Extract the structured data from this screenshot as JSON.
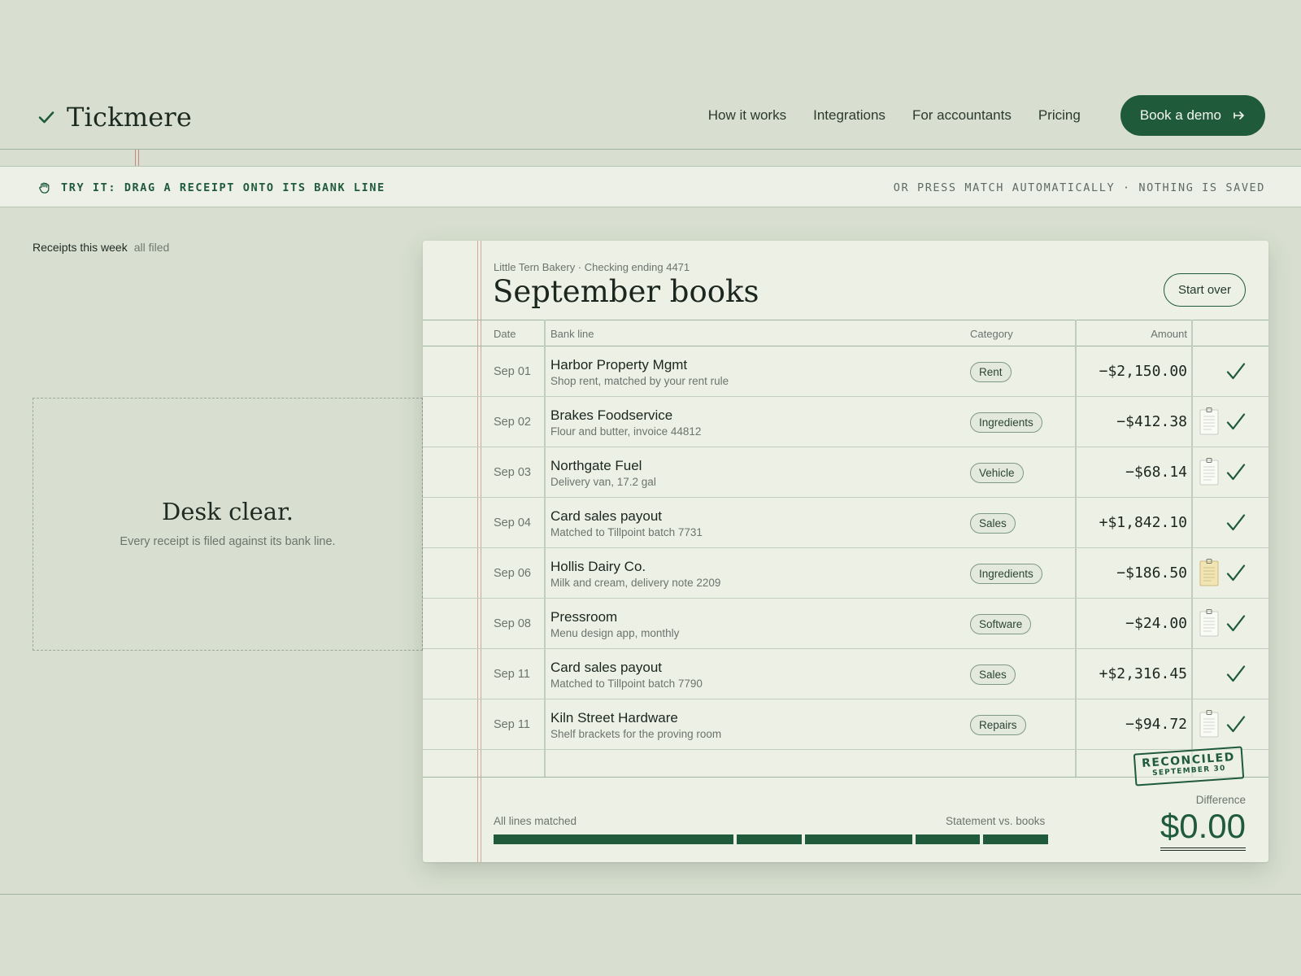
{
  "brand": {
    "name": "Tickmere",
    "icon": "check-icon"
  },
  "nav": {
    "links": [
      "How it works",
      "Integrations",
      "For accountants",
      "Pricing"
    ],
    "cta_label": "Book a demo"
  },
  "trybar": {
    "left_text": "TRY IT: DRAG A RECEIPT ONTO ITS BANK LINE",
    "right_text": "OR PRESS MATCH AUTOMATICALLY · NOTHING IS SAVED"
  },
  "receipts": {
    "title": "Receipts this week",
    "status": "all filed",
    "empty_title": "Desk clear.",
    "empty_sub": "Every receipt is filed against its bank line."
  },
  "ledger": {
    "account": "Little Tern Bakery · Checking ending 4471",
    "title": "September books",
    "start_over": "Start over",
    "columns": {
      "date": "Date",
      "bank_line": "Bank line",
      "category": "Category",
      "amount": "Amount"
    },
    "rows": [
      {
        "date": "Sep 01",
        "name": "Harbor Property Mgmt",
        "note": "Shop rent, matched by your rent rule",
        "category": "Rent",
        "amount": "−$2,150.00",
        "receipt": "none"
      },
      {
        "date": "Sep 02",
        "name": "Brakes Foodservice",
        "note": "Flour and butter, invoice 44812",
        "category": "Ingredients",
        "amount": "−$412.38",
        "receipt": "white"
      },
      {
        "date": "Sep 03",
        "name": "Northgate Fuel",
        "note": "Delivery van, 17.2 gal",
        "category": "Vehicle",
        "amount": "−$68.14",
        "receipt": "white"
      },
      {
        "date": "Sep 04",
        "name": "Card sales payout",
        "note": "Matched to Tillpoint batch 7731",
        "category": "Sales",
        "amount": "+$1,842.10",
        "receipt": "none"
      },
      {
        "date": "Sep 06",
        "name": "Hollis Dairy Co.",
        "note": "Milk and cream, delivery note 2209",
        "category": "Ingredients",
        "amount": "−$186.50",
        "receipt": "yellow"
      },
      {
        "date": "Sep 08",
        "name": "Pressroom",
        "note": "Menu design app, monthly",
        "category": "Software",
        "amount": "−$24.00",
        "receipt": "white"
      },
      {
        "date": "Sep 11",
        "name": "Card sales payout",
        "note": "Matched to Tillpoint batch 7790",
        "category": "Sales",
        "amount": "+$2,316.45",
        "receipt": "none"
      },
      {
        "date": "Sep 11",
        "name": "Kiln Street Hardware",
        "note": "Shelf brackets for the proving room",
        "category": "Repairs",
        "amount": "−$94.72",
        "receipt": "white"
      }
    ],
    "stamp": {
      "line1": "RECONCILED",
      "line2": "SEPTEMBER 30"
    },
    "footer": {
      "matched_label": "All lines matched",
      "statement_label": "Statement vs. books",
      "difference_label": "Difference",
      "difference_value": "$0.00",
      "progress_fraction": 1.0
    }
  },
  "colors": {
    "accent": "#1f5a3b",
    "background": "#d8dfd0",
    "card": "#edf0e5",
    "margin_red": "#d3a69c"
  }
}
